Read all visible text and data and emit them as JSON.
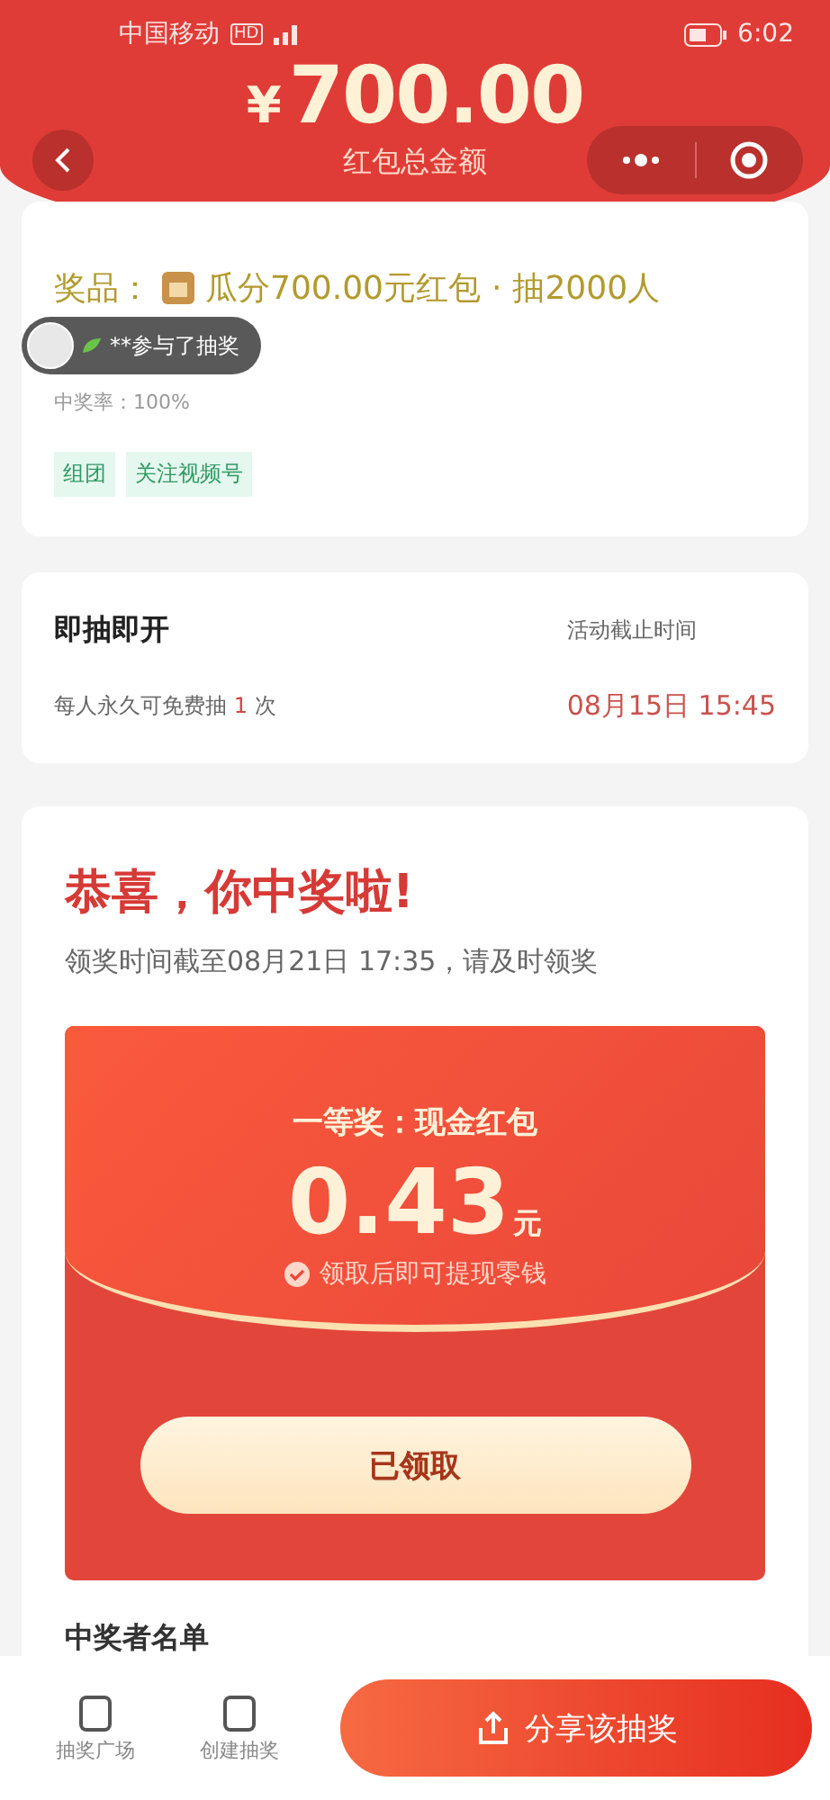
{
  "status_bar": {
    "carrier": "中国移动",
    "hd": "HD",
    "time": "6:02"
  },
  "header": {
    "currency": "¥",
    "amount": "700.00",
    "caption": "红包总金额"
  },
  "toast": {
    "text": "**参与了抽奖"
  },
  "prize_card": {
    "label": "奖品：",
    "prize": "瓜分700.00元红包",
    "separator": "·",
    "count": "抽2000人",
    "probability": "中奖率：100%",
    "tags": [
      "组团",
      "关注视频号"
    ]
  },
  "info_card": {
    "title": "即抽即开",
    "deadline_label": "活动截止时间",
    "rule_prefix": "每人永久可免费抽",
    "rule_count": "1",
    "rule_suffix": "次",
    "deadline": "08月15日 15:45"
  },
  "result_card": {
    "title": "恭喜，你中奖啦!",
    "subtitle": "领奖时间截至08月21日 17:35，请及时领奖",
    "envelope": {
      "prize": "一等奖：现金红包",
      "amount": "0.43",
      "unit": "元",
      "note": "领取后即可提现零钱",
      "button": {
        "label": "已领取",
        "disabled": true
      }
    },
    "winners_title": "中奖者名单"
  },
  "bottom_bar": {
    "items": [
      {
        "label": "抽奖广场"
      },
      {
        "label": "创建抽奖"
      }
    ],
    "share": "分享该抽奖"
  }
}
